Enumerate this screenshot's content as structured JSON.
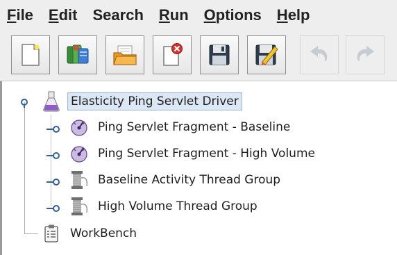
{
  "menubar": {
    "items": [
      {
        "mnemonic": "F",
        "rest": "ile"
      },
      {
        "mnemonic": "E",
        "rest": "dit"
      },
      {
        "mnemonic": "",
        "rest": "Search"
      },
      {
        "mnemonic": "R",
        "rest": "un"
      },
      {
        "mnemonic": "O",
        "rest": "ptions"
      },
      {
        "mnemonic": "H",
        "rest": "elp"
      }
    ]
  },
  "toolbar": {
    "buttons": [
      {
        "icon": "new-document-icon",
        "enabled": true
      },
      {
        "icon": "templates-icon",
        "enabled": true
      },
      {
        "icon": "open-folder-icon",
        "enabled": true
      },
      {
        "icon": "close-document-icon",
        "enabled": true
      },
      {
        "icon": "save-floppy-icon",
        "enabled": true
      },
      {
        "icon": "save-as-edit-icon",
        "enabled": true
      },
      {
        "icon": "undo-icon",
        "enabled": false
      },
      {
        "icon": "redo-icon",
        "enabled": false
      }
    ]
  },
  "tree": {
    "root": {
      "label": "Elasticity Ping Servlet Driver",
      "icon": "test-plan-flask-icon",
      "selected": true
    },
    "children": [
      {
        "label": "Ping Servlet Fragment - Baseline",
        "icon": "test-fragment-icon"
      },
      {
        "label": "Ping Servlet Fragment - High Volume",
        "icon": "test-fragment-icon"
      },
      {
        "label": "Baseline Activity Thread Group",
        "icon": "thread-group-spool-icon"
      },
      {
        "label": "High Volume Thread Group",
        "icon": "thread-group-spool-icon"
      }
    ],
    "workbench": {
      "label": "WorkBench",
      "icon": "workbench-clipboard-icon"
    }
  }
}
